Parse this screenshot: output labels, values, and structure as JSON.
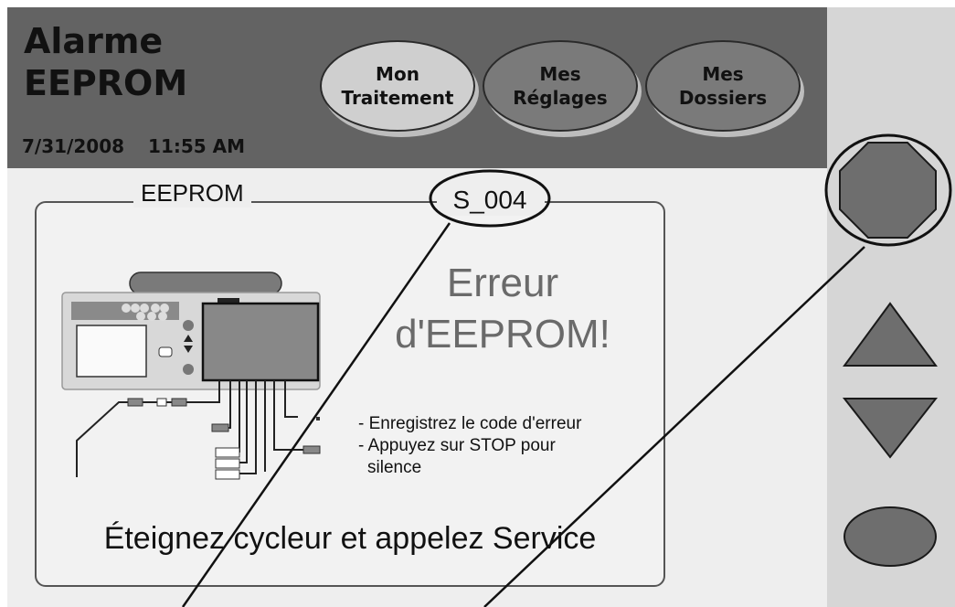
{
  "header": {
    "title_line1": "Alarme",
    "title_line2": "EEPROM",
    "date": "7/31/2008",
    "time": "11:55 AM"
  },
  "tabs": [
    {
      "line1": "Mon",
      "line2": "Traitement",
      "active": true
    },
    {
      "line1": "Mes",
      "line2": "Réglages",
      "active": false
    },
    {
      "line1": "Mes",
      "line2": "Dossiers",
      "active": false
    }
  ],
  "panel": {
    "legend": "EEPROM",
    "code": "S_004",
    "error_line1": "Erreur",
    "error_line2": "d'EEPROM!",
    "instruction_1": "- Enregistrez le code d'erreur",
    "instruction_2": "- Appuyez sur STOP pour",
    "instruction_3": "silence",
    "bottom_message": "Éteignez cycleur et appelez Service"
  },
  "side_buttons": {
    "stop": "stop-octagon-icon",
    "up": "triangle-up-icon",
    "down": "triangle-down-icon",
    "enter": "oval-button-icon"
  },
  "colors": {
    "header_bg": "#636363",
    "screen_bg": "#eeeeee",
    "sidebar_bg": "#d6d6d6",
    "button_fill": "#6e6e6e",
    "active_tab": "#cfcfcf"
  }
}
